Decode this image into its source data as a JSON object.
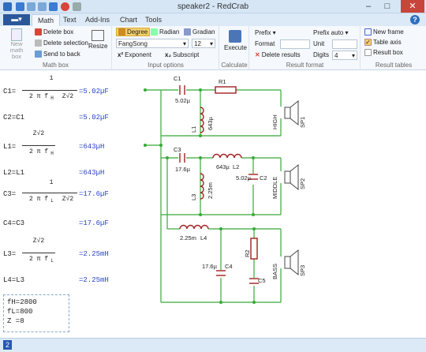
{
  "window": {
    "title": "speaker2 - RedCrab",
    "min": "–",
    "max": "□",
    "close": "✕"
  },
  "menu": {
    "tabs": [
      "Math",
      "Text",
      "Add-Ins",
      "Chart",
      "Tools"
    ],
    "help": "?"
  },
  "ribbon": {
    "math_box": {
      "new": "New math box",
      "delete": "Delete box",
      "delete_sel": "Delete selection",
      "send_back": "Send to back",
      "resize": "Resize",
      "label": "Math box"
    },
    "input": {
      "degree": "Degree",
      "radian": "Radian",
      "gradian": "Gradian",
      "font": "FangSong",
      "size": "12",
      "exponent": "Exponent",
      "subscript": "Subscript",
      "label": "Input options"
    },
    "calc": {
      "execute": "Execute",
      "label": "Calculate"
    },
    "format": {
      "prefix": "Prefix ▾",
      "prefix_auto": "Prefix auto ▾",
      "format_label": "Format",
      "unit_label": "Unit",
      "delete_results": "Delete results",
      "digits_label": "Digits",
      "digits": "4",
      "label": "Result format"
    },
    "tables": {
      "new_frame": "New frame",
      "table_axis": "Table axis",
      "result_box": "Result box",
      "label": "Result tables"
    }
  },
  "equations": [
    {
      "lhs": "C1=",
      "num": "1",
      "den": "2 π f",
      "den_sub": "H",
      "den2": "Z√2",
      "res": "=5.02µF"
    },
    {
      "lhs": "C2=C1",
      "res": "=5.02µF"
    },
    {
      "lhs": "L1=",
      "num": "Z√2",
      "den": "2 π f",
      "den_sub": "H",
      "res": "=643µH"
    },
    {
      "lhs": "L2=L1",
      "res": "=643µH"
    },
    {
      "lhs": "C3=",
      "num": "1",
      "den": "2 π f",
      "den_sub": "L",
      "den2": "Z√2",
      "res": "=17.6µF"
    },
    {
      "lhs": "C4=C3",
      "res": "=17.6µF"
    },
    {
      "lhs": "L3=",
      "num": "Z√2",
      "den": "2 π f",
      "den_sub": "L",
      "res": "=2.25mH"
    },
    {
      "lhs": "L4=L3",
      "res": "=2.25mH"
    }
  ],
  "variables": [
    "fH=2800",
    "fL=800",
    "Z =8"
  ],
  "circuit": {
    "C1": "C1",
    "C1v": "5.02µ",
    "R1": "R1",
    "L1": "L1",
    "L1v": "643µ",
    "HIGH": "HIGH",
    "SP1": "SP1",
    "C3": "C3",
    "C3v": "17.6µ",
    "L2v": "643µ",
    "L2": "L2",
    "L3": "L3",
    "L3v": "2.25m",
    "C2v": "5.02µ",
    "C2": "C2",
    "MIDDLE": "MIDDLE",
    "SP2": "SP2",
    "L4v": "2.25m",
    "L4": "L4",
    "R2": "R2",
    "C4v": "17.6µ",
    "C4": "C4",
    "C5": "C5",
    "BASS": "BASS",
    "SP3": "SP3"
  },
  "status": {
    "page": "2"
  }
}
